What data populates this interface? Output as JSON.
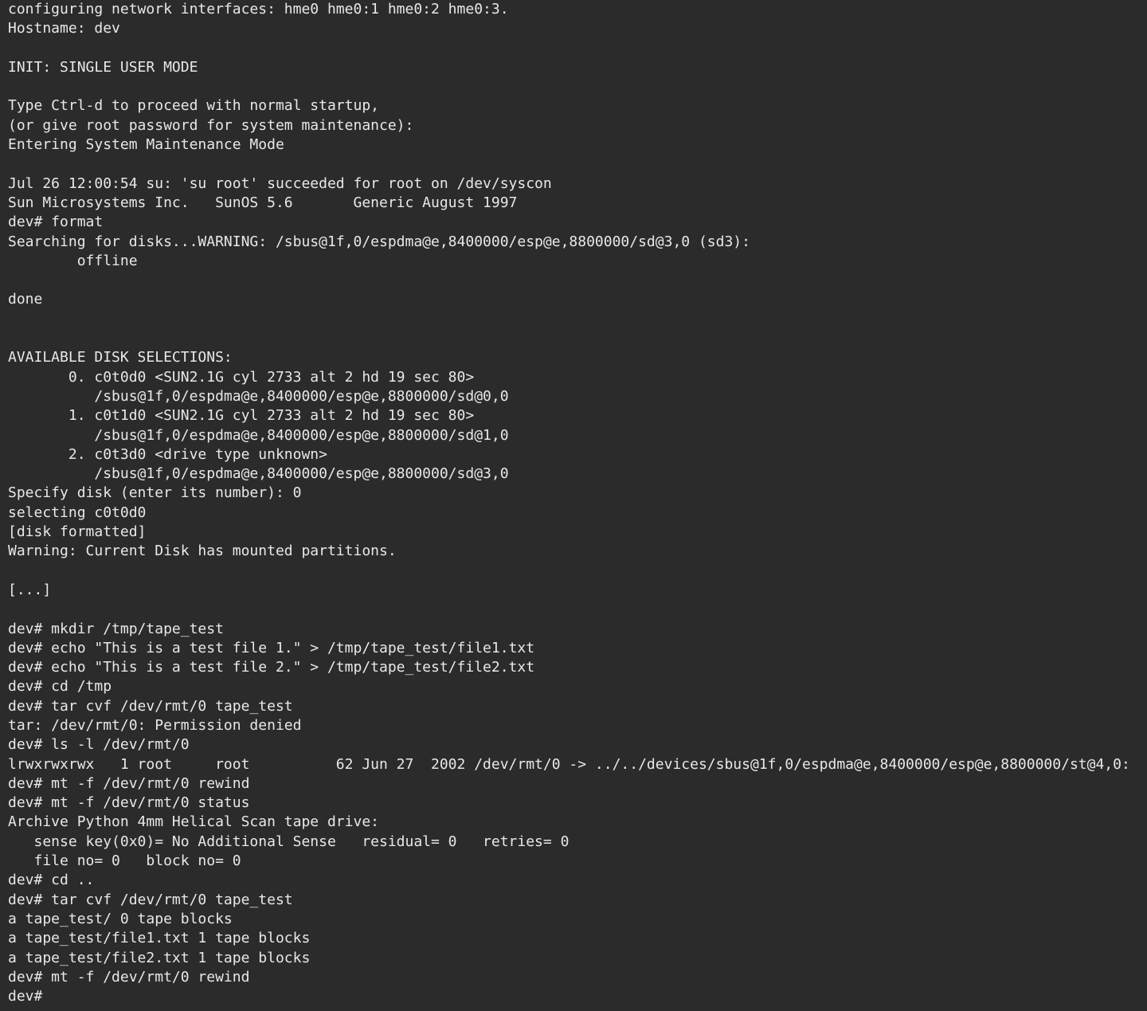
{
  "terminal": {
    "lines": [
      "configuring network interfaces: hme0 hme0:1 hme0:2 hme0:3.",
      "Hostname: dev",
      "",
      "INIT: SINGLE USER MODE",
      "",
      "Type Ctrl-d to proceed with normal startup,",
      "(or give root password for system maintenance):",
      "Entering System Maintenance Mode",
      "",
      "Jul 26 12:00:54 su: 'su root' succeeded for root on /dev/syscon",
      "Sun Microsystems Inc.   SunOS 5.6       Generic August 1997",
      "dev# format",
      "Searching for disks...WARNING: /sbus@1f,0/espdma@e,8400000/esp@e,8800000/sd@3,0 (sd3):",
      "        offline",
      "",
      "done",
      "",
      "",
      "AVAILABLE DISK SELECTIONS:",
      "       0. c0t0d0 <SUN2.1G cyl 2733 alt 2 hd 19 sec 80>",
      "          /sbus@1f,0/espdma@e,8400000/esp@e,8800000/sd@0,0",
      "       1. c0t1d0 <SUN2.1G cyl 2733 alt 2 hd 19 sec 80>",
      "          /sbus@1f,0/espdma@e,8400000/esp@e,8800000/sd@1,0",
      "       2. c0t3d0 <drive type unknown>",
      "          /sbus@1f,0/espdma@e,8400000/esp@e,8800000/sd@3,0",
      "Specify disk (enter its number): 0",
      "selecting c0t0d0",
      "[disk formatted]",
      "Warning: Current Disk has mounted partitions.",
      "",
      "[...]",
      "",
      "dev# mkdir /tmp/tape_test",
      "dev# echo \"This is a test file 1.\" > /tmp/tape_test/file1.txt",
      "dev# echo \"This is a test file 2.\" > /tmp/tape_test/file2.txt",
      "dev# cd /tmp",
      "dev# tar cvf /dev/rmt/0 tape_test",
      "tar: /dev/rmt/0: Permission denied",
      "dev# ls -l /dev/rmt/0",
      "lrwxrwxrwx   1 root     root          62 Jun 27  2002 /dev/rmt/0 -> ../../devices/sbus@1f,0/espdma@e,8400000/esp@e,8800000/st@4,0:",
      "dev# mt -f /dev/rmt/0 rewind",
      "dev# mt -f /dev/rmt/0 status",
      "Archive Python 4mm Helical Scan tape drive:",
      "   sense key(0x0)= No Additional Sense   residual= 0   retries= 0",
      "   file no= 0   block no= 0",
      "dev# cd ..",
      "dev# tar cvf /dev/rmt/0 tape_test",
      "a tape_test/ 0 tape blocks",
      "a tape_test/file1.txt 1 tape blocks",
      "a tape_test/file2.txt 1 tape blocks",
      "dev# mt -f /dev/rmt/0 rewind",
      "dev#"
    ]
  }
}
